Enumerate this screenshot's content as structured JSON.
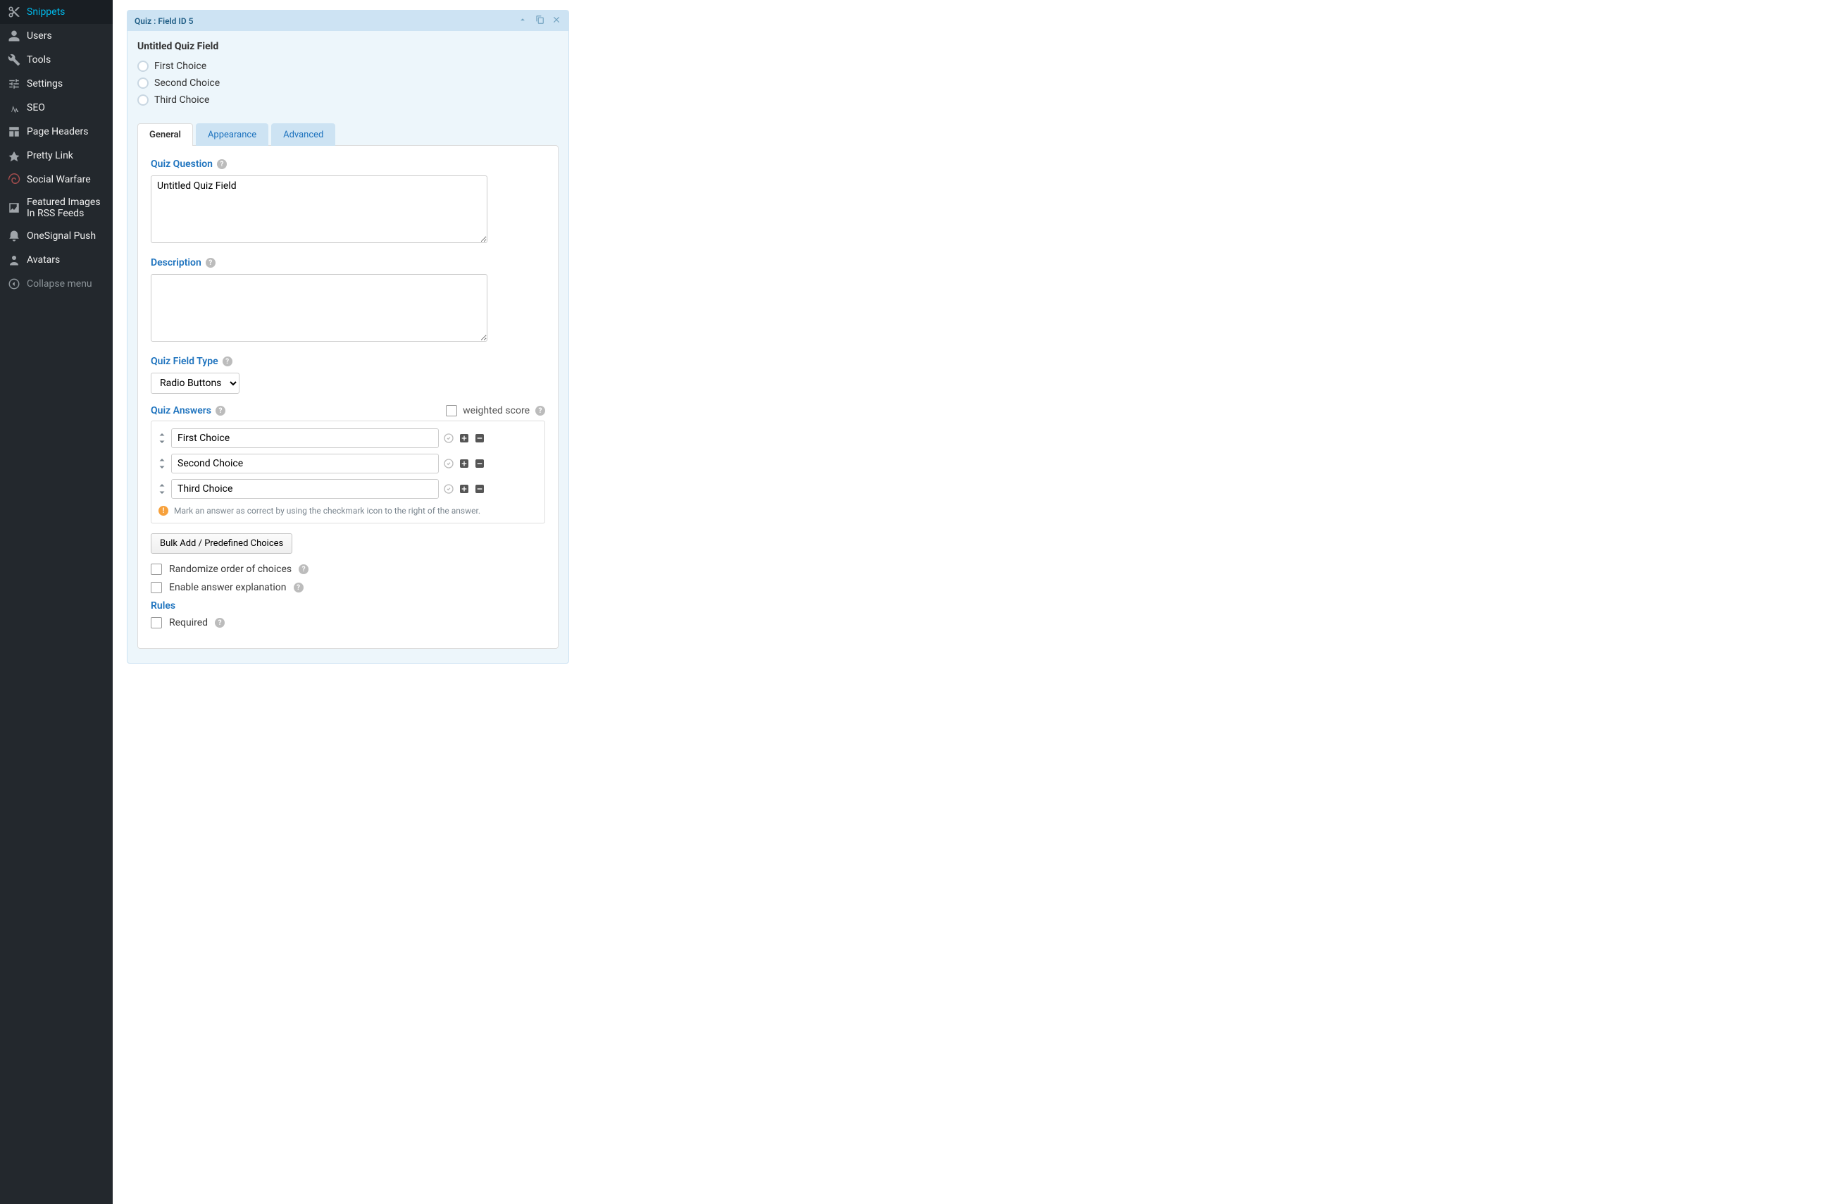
{
  "sidebar": {
    "items": [
      {
        "id": "snippets",
        "label": "Snippets"
      },
      {
        "id": "users",
        "label": "Users"
      },
      {
        "id": "tools",
        "label": "Tools"
      },
      {
        "id": "settings",
        "label": "Settings"
      },
      {
        "id": "seo",
        "label": "SEO"
      },
      {
        "id": "page-headers",
        "label": "Page Headers"
      },
      {
        "id": "pretty-link",
        "label": "Pretty Link"
      },
      {
        "id": "social-warfare",
        "label": "Social Warfare"
      },
      {
        "id": "featured-images",
        "label": "Featured Images In RSS Feeds"
      },
      {
        "id": "onesignal",
        "label": "OneSignal Push"
      },
      {
        "id": "avatars",
        "label": "Avatars"
      },
      {
        "id": "collapse",
        "label": "Collapse menu"
      }
    ]
  },
  "panel": {
    "header": "Quiz : Field ID 5"
  },
  "preview": {
    "title": "Untitled Quiz Field",
    "choices": [
      "First Choice",
      "Second Choice",
      "Third Choice"
    ]
  },
  "tabs": {
    "general": "General",
    "appearance": "Appearance",
    "advanced": "Advanced"
  },
  "form": {
    "quiz_question_label": "Quiz Question",
    "quiz_question_value": "Untitled Quiz Field",
    "description_label": "Description",
    "description_value": "",
    "field_type_label": "Quiz Field Type",
    "field_type_value": "Radio Buttons",
    "answers_label": "Quiz Answers",
    "weighted_label": "weighted score",
    "answers": [
      "First Choice",
      "Second Choice",
      "Third Choice"
    ],
    "answers_hint": "Mark an answer as correct by using the checkmark icon to the right of the answer.",
    "bulk_add_label": "Bulk Add / Predefined Choices",
    "randomize_label": "Randomize order of choices",
    "enable_explanation_label": "Enable answer explanation",
    "rules_label": "Rules",
    "required_label": "Required"
  }
}
